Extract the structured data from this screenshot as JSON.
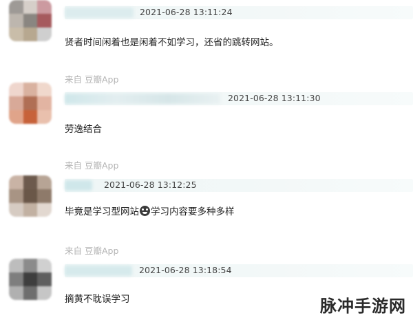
{
  "comments": [
    {
      "source": "",
      "timestamp": "2021-06-28 13:11:24",
      "text": "贤者时间闲着也是闲着不如学习，还省的跳转网站。",
      "avatar_colors": [
        "#9e9a96",
        "#d6cfc9",
        "#cc9aa0",
        "#bdb6ae",
        "#8a8681",
        "#a65a5e",
        "#c9bda9",
        "#b7a890",
        "#cfcfcf"
      ]
    },
    {
      "source": "来自 豆瓣App",
      "timestamp": "2021-06-28 13:11:30",
      "text": "劳逸结合",
      "avatar_colors": [
        "#efd6cd",
        "#d9b2a0",
        "#f0d8cc",
        "#d8a998",
        "#b06f55",
        "#e2b4a2",
        "#e0a48a",
        "#c7623a",
        "#e9c0ad"
      ]
    },
    {
      "source": "来自 豆瓣App",
      "timestamp": "2021-06-28 13:12:25",
      "text_before": "毕竟是学习型网站",
      "text_after": "学习内容要多种多样",
      "avatar_colors": [
        "#c9b3a5",
        "#6d5a4d",
        "#b7a495",
        "#a89484",
        "#6a5748",
        "#8e7a6a",
        "#d6cbc2",
        "#c2b1a2",
        "#e2d8d0"
      ]
    },
    {
      "source": "来自 豆瓣App",
      "timestamp": "2021-06-28 13:18:54",
      "text": "摘黄不耽误学习",
      "avatar_colors": [
        "#bdbdbd",
        "#8b8b8b",
        "#d0d0d0",
        "#7e7e7e",
        "#3e3e3e",
        "#5f5f5f",
        "#b0b0b0",
        "#6e6e6e",
        "#c6c6c6"
      ]
    }
  ],
  "watermark": "脉冲手游网"
}
